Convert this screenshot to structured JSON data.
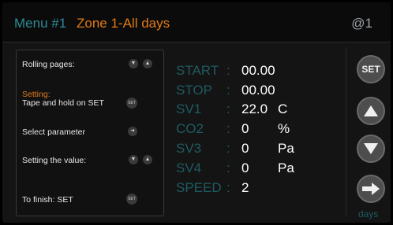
{
  "header": {
    "menu": "Menu #1",
    "zone": "Zone 1-All days",
    "device": "@1"
  },
  "help": {
    "rolling": "Rolling pages:",
    "setting_title": "Setting:",
    "tape_hold": "Tape and hold on SET",
    "select_param": "Select parameter",
    "setting_value": "Setting the value:",
    "finish": "To finish: SET",
    "set_badge": "SET"
  },
  "params": [
    {
      "label": "START",
      "sep": ":",
      "value": "00.00",
      "unit": ""
    },
    {
      "label": "STOP",
      "sep": ":",
      "value": "00.00",
      "unit": ""
    },
    {
      "label": "SV1",
      "sep": ":",
      "value": "22.0",
      "unit": "C"
    },
    {
      "label": "CO2",
      "sep": ":",
      "value": "0",
      "unit": "%"
    },
    {
      "label": "SV3",
      "sep": ":",
      "value": "0",
      "unit": "Pa"
    },
    {
      "label": "SV4",
      "sep": ":",
      "value": "0",
      "unit": "Pa"
    },
    {
      "label": "SPEED",
      "sep": ":",
      "value": "2",
      "unit": ""
    }
  ],
  "side": {
    "set_label": "SET",
    "days_label": "days"
  },
  "icons": {
    "set": "set-icon",
    "up": "arrow-up-icon",
    "down": "arrow-down-icon",
    "right": "arrow-right-icon"
  },
  "colors": {
    "background": "#000000",
    "teal": "#2d8c96",
    "orange": "#e07a18",
    "value": "#ffffff"
  }
}
